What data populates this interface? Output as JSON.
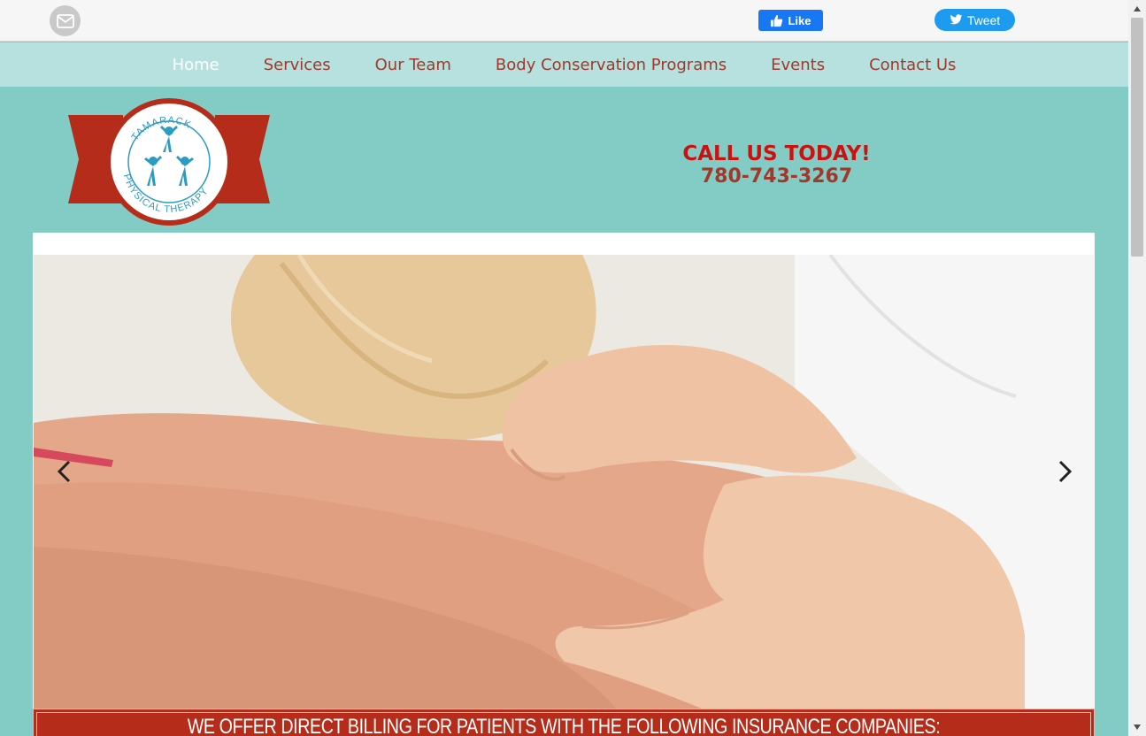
{
  "topbar": {
    "mail_icon": "envelope-icon",
    "facebook": {
      "label": "Like",
      "icon": "thumbs-up-icon",
      "color": "#1877f2"
    },
    "twitter": {
      "label": "Tweet",
      "icon": "twitter-bird-icon",
      "color": "#1d9bf0"
    }
  },
  "nav": {
    "items": [
      {
        "label": "Home",
        "active": true
      },
      {
        "label": "Services"
      },
      {
        "label": "Our Team"
      },
      {
        "label": "Body Conservation Programs"
      },
      {
        "label": "Events"
      },
      {
        "label": "Contact Us"
      }
    ]
  },
  "header": {
    "logo": {
      "top_text": "TAMARACK",
      "bottom_text": "PHYSICAL THERAPY"
    },
    "call_title": "CALL US TODAY!",
    "phone": "780-743-3267"
  },
  "slider": {
    "image_subject": "therapist hands massaging shoulder",
    "prev_icon": "chevron-left-icon",
    "next_icon": "chevron-right-icon"
  },
  "banner": {
    "text": "WE OFFER DIRECT BILLING FOR PATIENTS WITH THE FOLLOWING INSURANCE COMPANIES:"
  },
  "colors": {
    "page_bg": "#82ccc5",
    "nav_bg": "#b6e1de",
    "brand_red": "#b52d1a",
    "nav_link": "#a0392c",
    "call_red": "#cc1111"
  }
}
